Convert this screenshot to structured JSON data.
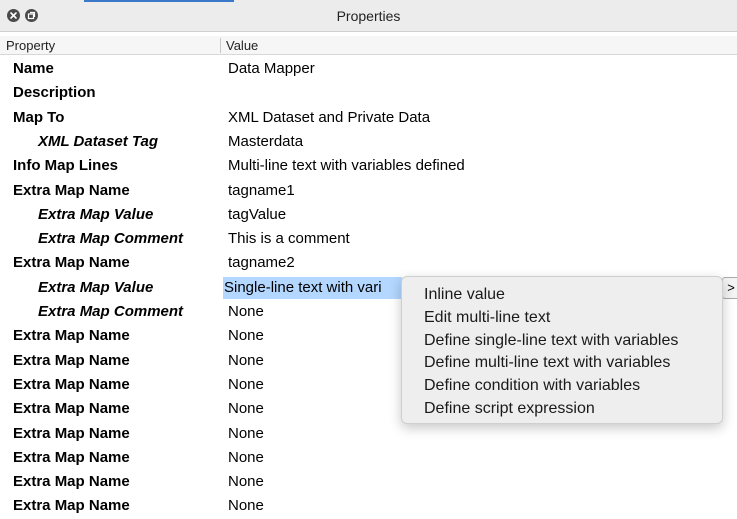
{
  "window": {
    "title": "Properties"
  },
  "columns": {
    "property": "Property",
    "value": "Value"
  },
  "rows": [
    {
      "property": "Name",
      "value": "Data Mapper",
      "child": false
    },
    {
      "property": "Description",
      "value": "",
      "child": false
    },
    {
      "property": "Map To",
      "value": "XML Dataset and Private Data",
      "child": false
    },
    {
      "property": "XML Dataset Tag",
      "value": "Masterdata",
      "child": true
    },
    {
      "property": "Info Map Lines",
      "value": "Multi-line text with variables defined",
      "child": false
    },
    {
      "property": "Extra Map Name",
      "value": "tagname1",
      "child": false
    },
    {
      "property": "Extra Map Value",
      "value": "tagValue",
      "child": true
    },
    {
      "property": "Extra Map Comment",
      "value": "This is a comment",
      "child": true
    },
    {
      "property": "Extra Map Name",
      "value": "tagname2",
      "child": false
    },
    {
      "property": "Extra Map Value",
      "value": "Single-line text with vari",
      "child": true,
      "selected": true
    },
    {
      "property": "Extra Map Comment",
      "value": "None",
      "child": true
    },
    {
      "property": "Extra Map Name",
      "value": "None",
      "child": false
    },
    {
      "property": "Extra Map Name",
      "value": "None",
      "child": false
    },
    {
      "property": "Extra Map Name",
      "value": "None",
      "child": false
    },
    {
      "property": "Extra Map Name",
      "value": "None",
      "child": false
    },
    {
      "property": "Extra Map Name",
      "value": "None",
      "child": false
    },
    {
      "property": "Extra Map Name",
      "value": "None",
      "child": false
    },
    {
      "property": "Extra Map Name",
      "value": "None",
      "child": false
    },
    {
      "property": "Extra Map Name",
      "value": "None",
      "child": false
    }
  ],
  "expander": {
    "label": ">"
  },
  "context_menu": {
    "items": [
      "Inline value",
      "Edit multi-line text",
      "Define single-line text with variables",
      "Define multi-line text with variables",
      "Define condition with variables",
      "Define script expression"
    ]
  },
  "icons": {
    "close": "close-icon",
    "restore": "restore-icon"
  },
  "colors": {
    "selection": "#b3d7ff",
    "menu_bg": "#eeeeee",
    "titlebar": "#ececec"
  }
}
